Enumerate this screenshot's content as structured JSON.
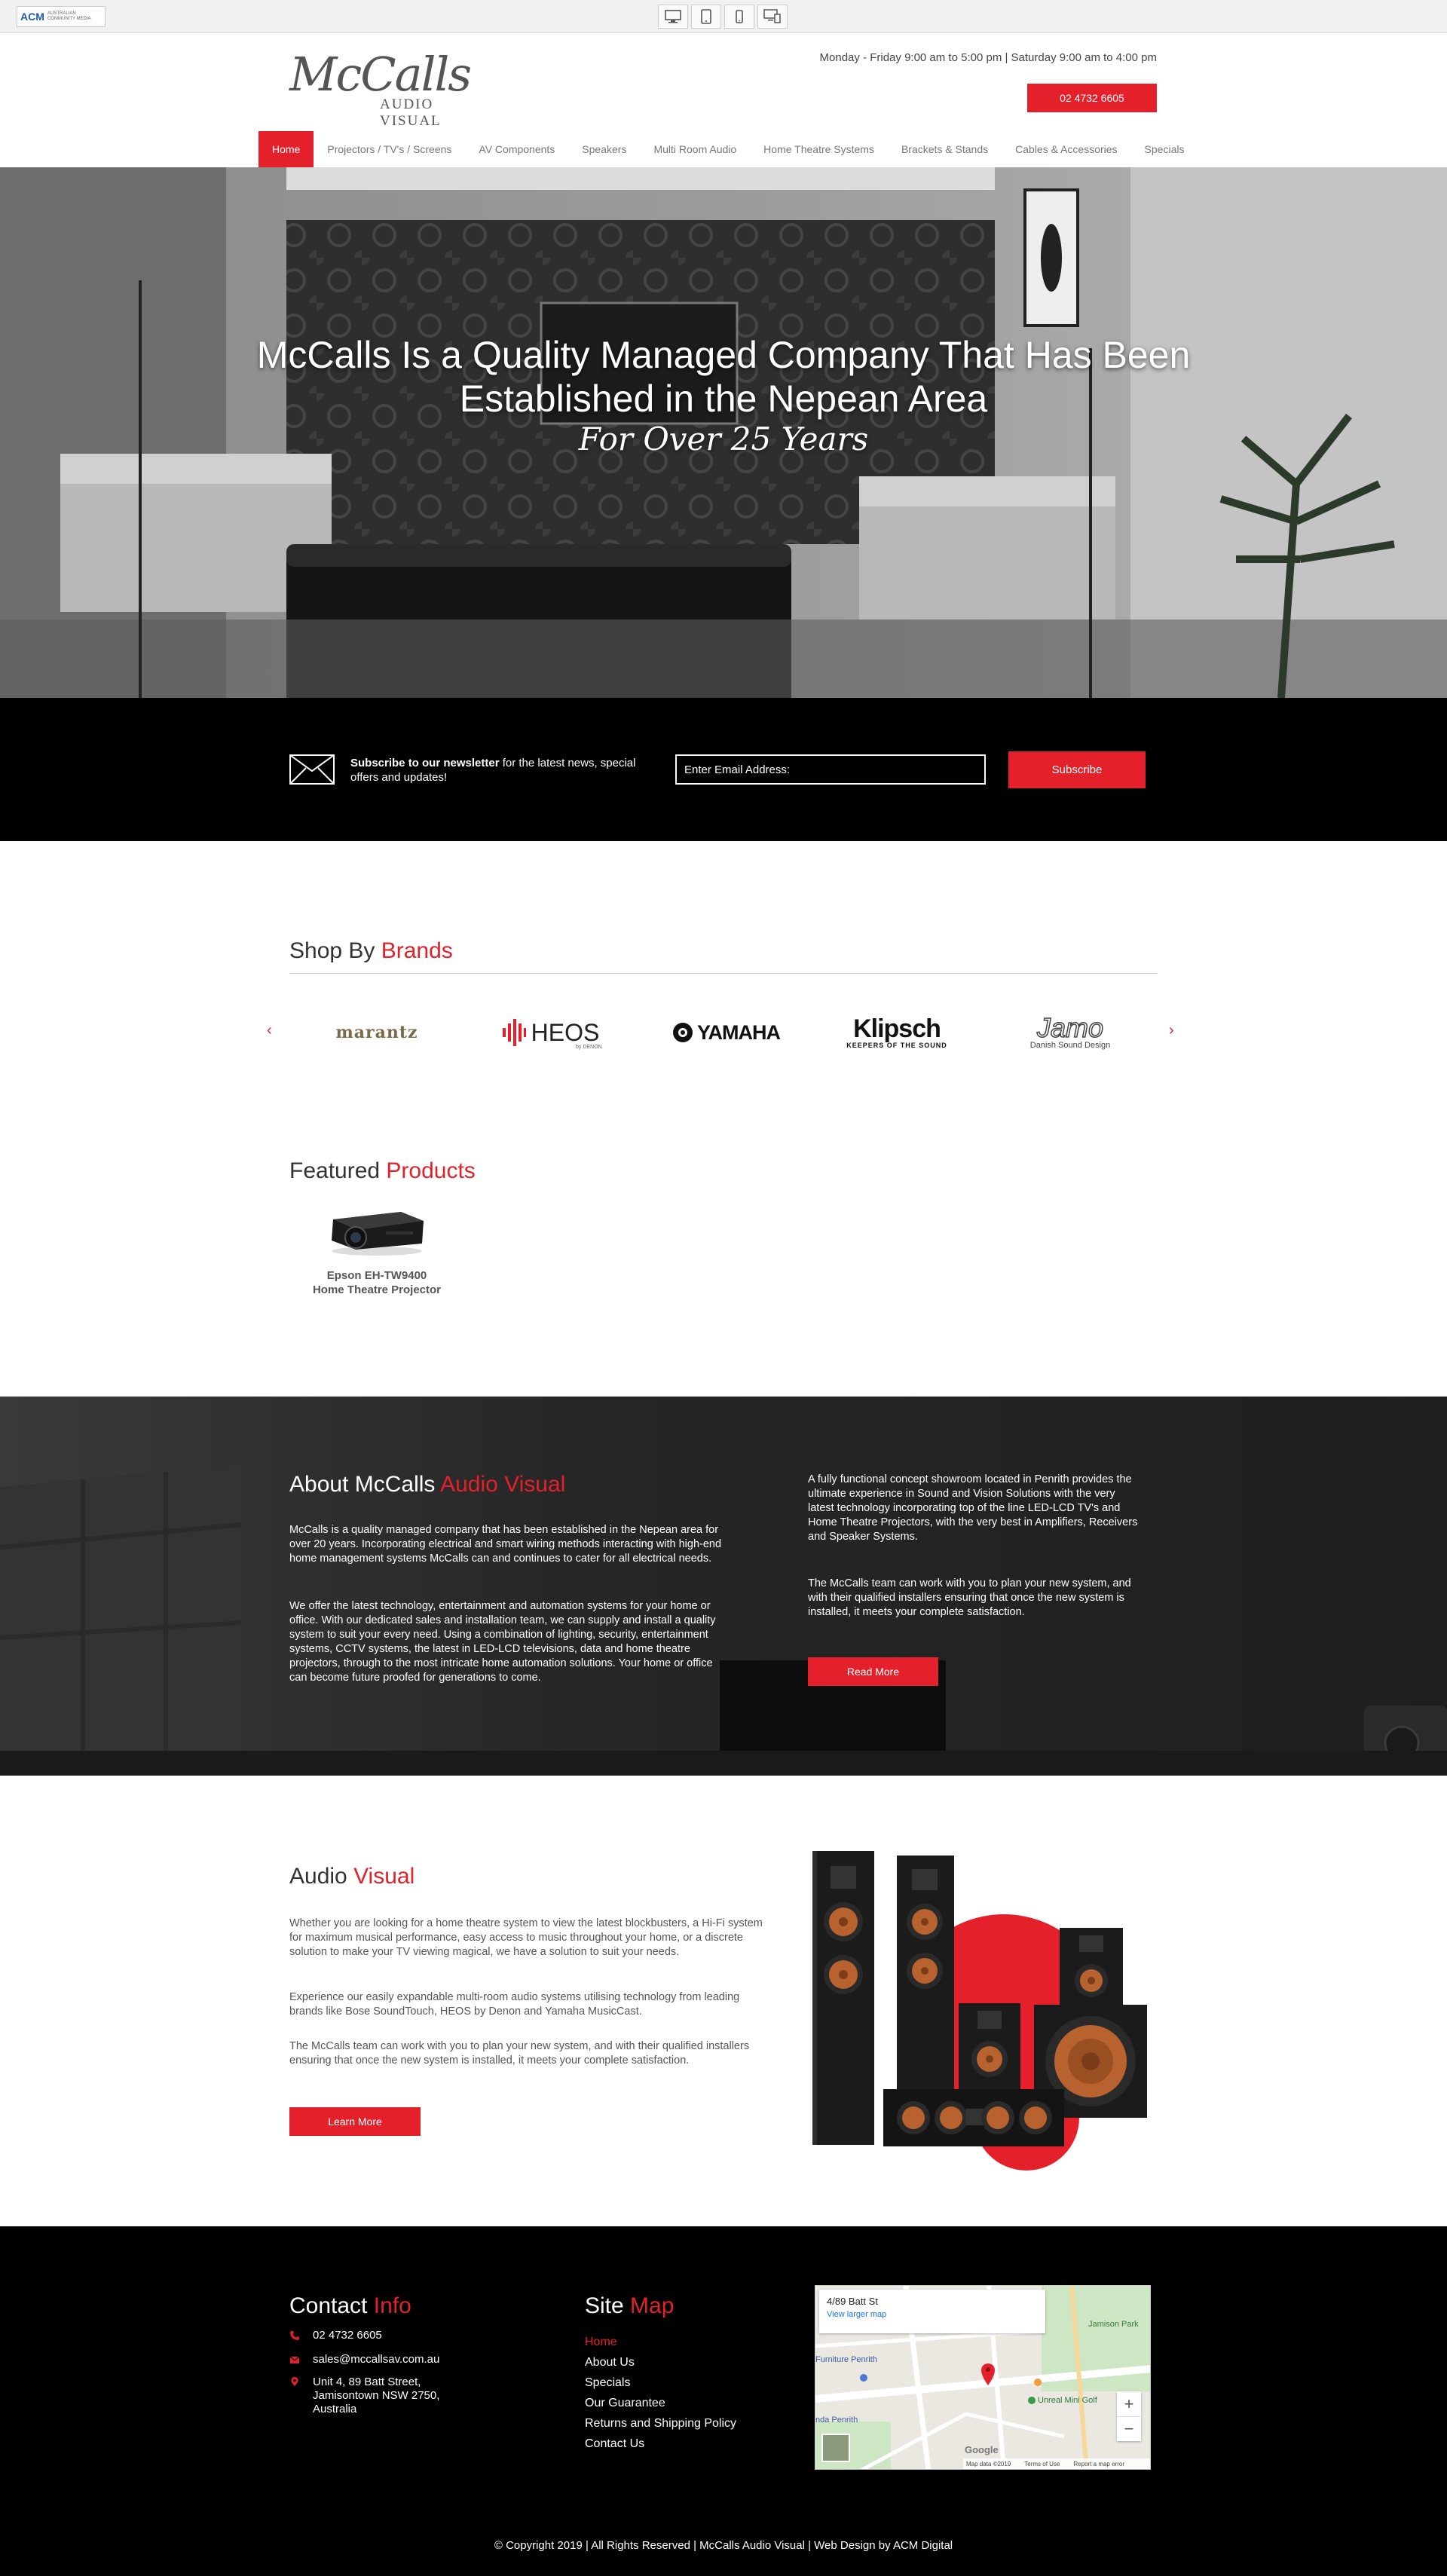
{
  "toolbar": {
    "logo_text": "ACM",
    "logo_sub": "AUSTRALIAN COMMUNITY MEDIA",
    "devices": [
      "desktop-icon",
      "tablet-icon",
      "mobile-icon",
      "responsive-icon"
    ]
  },
  "header": {
    "logo_main": "McCalls",
    "logo_sub": "AUDIO VISUAL",
    "hours": "Monday - Friday 9:00 am to 5:00 pm | Saturday 9:00 am to 4:00 pm",
    "phone": "02 4732 6605"
  },
  "nav": {
    "items": [
      {
        "label": "Home"
      },
      {
        "label": "Projectors / TV's / Screens"
      },
      {
        "label": "AV Components"
      },
      {
        "label": "Speakers"
      },
      {
        "label": "Multi Room Audio"
      },
      {
        "label": "Home Theatre Systems"
      },
      {
        "label": "Brackets & Stands"
      },
      {
        "label": "Cables & Accessories"
      },
      {
        "label": "Specials"
      }
    ]
  },
  "hero": {
    "line1": "McCalls Is a Quality Managed Company That Has Been",
    "line2": "Established in the Nepean Area",
    "script": "For Over 25 Years"
  },
  "newsletter": {
    "bold": "Subscribe to our newsletter",
    "rest": " for the latest news, special offers and updates!",
    "placeholder": "Enter Email Address:",
    "button": "Subscribe"
  },
  "brands": {
    "heading_a": "Shop By ",
    "heading_b": "Brands",
    "items": [
      "marantz",
      "HEOS",
      "YAMAHA",
      "Klipsch",
      "Jamo"
    ],
    "heos_sub": "by DENON",
    "klipsch_sub": "KEEPERS OF THE SOUND",
    "jamo_sub": "Danish Sound Design"
  },
  "featured": {
    "heading_a": "Featured ",
    "heading_b": "Products",
    "product_line1": "Epson EH-TW9400",
    "product_line2": "Home Theatre Projector"
  },
  "about": {
    "heading_a": "About McCalls ",
    "heading_b": "Audio Visual",
    "p1": "McCalls is a quality managed company that has been established in the Nepean area for over 20 years. Incorporating electrical and smart wiring methods interacting with high-end home management systems McCalls can and continues to cater for all electrical needs.",
    "p2": "We offer the latest technology, entertainment and automation systems for your home or office. With our dedicated sales and installation team, we can supply and install a quality system to suit your every need. Using a combination of lighting, security, entertainment systems, CCTV systems, the latest in LED-LCD televisions, data and home theatre projectors, through to the most intricate home automation solutions. Your home or office can become future proofed for generations to come.",
    "p3": "A fully functional concept showroom located in Penrith provides the ultimate experience in Sound and Vision Solutions with the very latest technology incorporating top of the line LED-LCD TV's and Home Theatre Projectors, with the very best in Amplifiers, Receivers and Speaker Systems.",
    "p4": "The McCalls team can work with you to plan your new system, and with their qualified installers ensuring that once the new system is installed, it meets your complete satisfaction.",
    "button": "Read More"
  },
  "audio": {
    "heading_a": "Audio ",
    "heading_b": "Visual",
    "p1": "Whether you are looking for a home theatre system to view the latest blockbusters, a Hi-Fi system for maximum musical performance, easy access to music throughout your home, or a discrete solution to make your TV viewing magical, we have a solution to suit your needs.",
    "p2": "Experience our easily expandable multi-room audio systems utilising technology from leading brands like Bose SoundTouch, HEOS by Denon and Yamaha MusicCast.",
    "p3": "The McCalls team can work with you to plan your new system, and with their qualified installers ensuring that once the new system is installed, it meets your complete satisfaction.",
    "button": "Learn More"
  },
  "footer": {
    "contact_a": "Contact ",
    "contact_b": "Info",
    "phone": "02 4732 6605",
    "email": "sales@mccallsav.com.au",
    "address1": "Unit 4, 89 Batt Street,",
    "address2": "Jamisontown NSW 2750,",
    "address3": "Australia",
    "sitemap_a": "Site ",
    "sitemap_b": "Map",
    "links": [
      "Home",
      "About Us",
      "Specials",
      "Our Guarantee",
      "Returns and Shipping Policy",
      "Contact Us"
    ],
    "map": {
      "address": "4/89 Batt St",
      "larger": "View larger map",
      "park": "Jamison Park",
      "golf": "Unreal Mini Golf",
      "furniture": "Furniture Penrith",
      "penrith": "nda Penrith",
      "zoom_in": "+",
      "zoom_out": "−",
      "brand": "Google",
      "data": "Map data ©2019",
      "terms": "Terms of Use",
      "report": "Report a map error"
    },
    "copyright": "© Copyright 2019 | All Rights Reserved | McCalls Audio Visual | Web Design by ACM Digital"
  },
  "colors": {
    "accent": "#e4212a",
    "dark": "#000000",
    "text": "#333333"
  }
}
